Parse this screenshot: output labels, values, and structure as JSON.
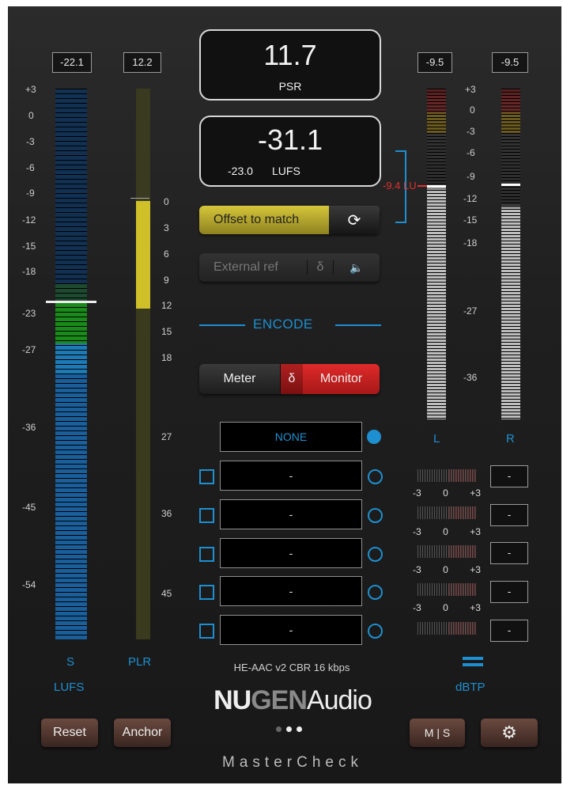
{
  "colors": {
    "accent_blue": "#1e8fd0",
    "yellow": "#cfc02a",
    "red": "#c82020"
  },
  "left": {
    "s_value": "-22.1",
    "plr_value": "12.2",
    "s_scale": [
      "+3",
      "0",
      "-3",
      "-6",
      "-9",
      "-12",
      "-15",
      "-18",
      "-23",
      "-27",
      "-36",
      "-45",
      "-54"
    ],
    "plr_scale": [
      "0",
      "3",
      "6",
      "9",
      "12",
      "15",
      "18",
      "27",
      "36",
      "45"
    ],
    "s_label": "S",
    "plr_label": "PLR",
    "units": "LUFS"
  },
  "center": {
    "psr_value": "11.7",
    "psr_label": "PSR",
    "lufs_value": "-31.1",
    "lufs_target": "-23.0",
    "lufs_unit": "LUFS",
    "offset_label": "-9.4 LU",
    "offset_button": "Offset to match",
    "refresh_icon": "refresh-icon",
    "external_ref": "External ref",
    "delta": "δ",
    "speaker_icon": "speaker-icon",
    "encode_label": "ENCODE",
    "meter_label": "Meter",
    "monitor_label": "Monitor",
    "slots": [
      "NONE",
      "-",
      "-",
      "-",
      "-",
      "-"
    ],
    "codec": "HE-AAC v2 CBR 16 kbps",
    "brand_nu": "NU",
    "brand_gen": "GEN",
    "brand_audio": "Audio",
    "product": "MasterCheck"
  },
  "right": {
    "l_value": "-9.5",
    "r_value": "-9.5",
    "scale": [
      "+3",
      "0",
      "-3",
      "-6",
      "-9",
      "-12",
      "-15",
      "-18",
      "-27",
      "-36"
    ],
    "l_label": "L",
    "r_label": "R",
    "tp_scale": [
      "-3",
      "0",
      "+3"
    ],
    "tp_values": [
      "-",
      "-",
      "-",
      "-",
      "-"
    ],
    "units": "dBTP"
  },
  "buttons": {
    "reset": "Reset",
    "anchor": "Anchor",
    "ms": "M | S",
    "settings_icon": "gear-icon"
  }
}
